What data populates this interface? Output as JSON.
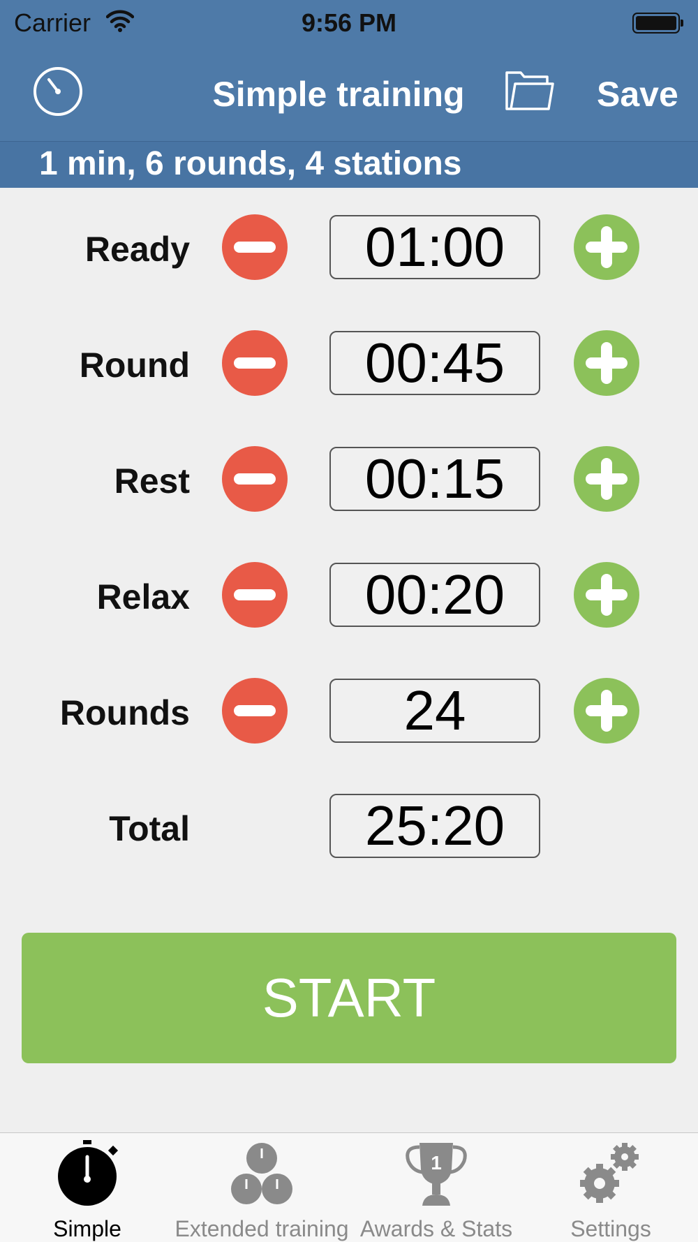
{
  "status_bar": {
    "carrier": "Carrier",
    "time": "9:56 PM"
  },
  "nav": {
    "title": "Simple training",
    "save_label": "Save",
    "left_icon": "stopwatch-icon",
    "right_icon": "folder-icon"
  },
  "subheader": "1 min, 6 rounds, 4 stations",
  "rows": [
    {
      "label": "Ready",
      "value": "01:00"
    },
    {
      "label": "Round",
      "value": "00:45"
    },
    {
      "label": "Rest",
      "value": "00:15"
    },
    {
      "label": "Relax",
      "value": "00:20"
    },
    {
      "label": "Rounds",
      "value": "24"
    }
  ],
  "total": {
    "label": "Total",
    "value": "25:20"
  },
  "start_label": "START",
  "tabs": [
    {
      "label": "Simple",
      "icon": "stopwatch-icon",
      "active": true
    },
    {
      "label": "Extended training",
      "icon": "multi-stopwatch-icon",
      "active": false
    },
    {
      "label": "Awards & Stats",
      "icon": "trophy-icon",
      "active": false
    },
    {
      "label": "Settings",
      "icon": "gears-icon",
      "active": false
    }
  ],
  "colors": {
    "header": "#4e7aa8",
    "minus": "#e85a47",
    "plus": "#8cc15a",
    "start": "#8cc15a"
  }
}
